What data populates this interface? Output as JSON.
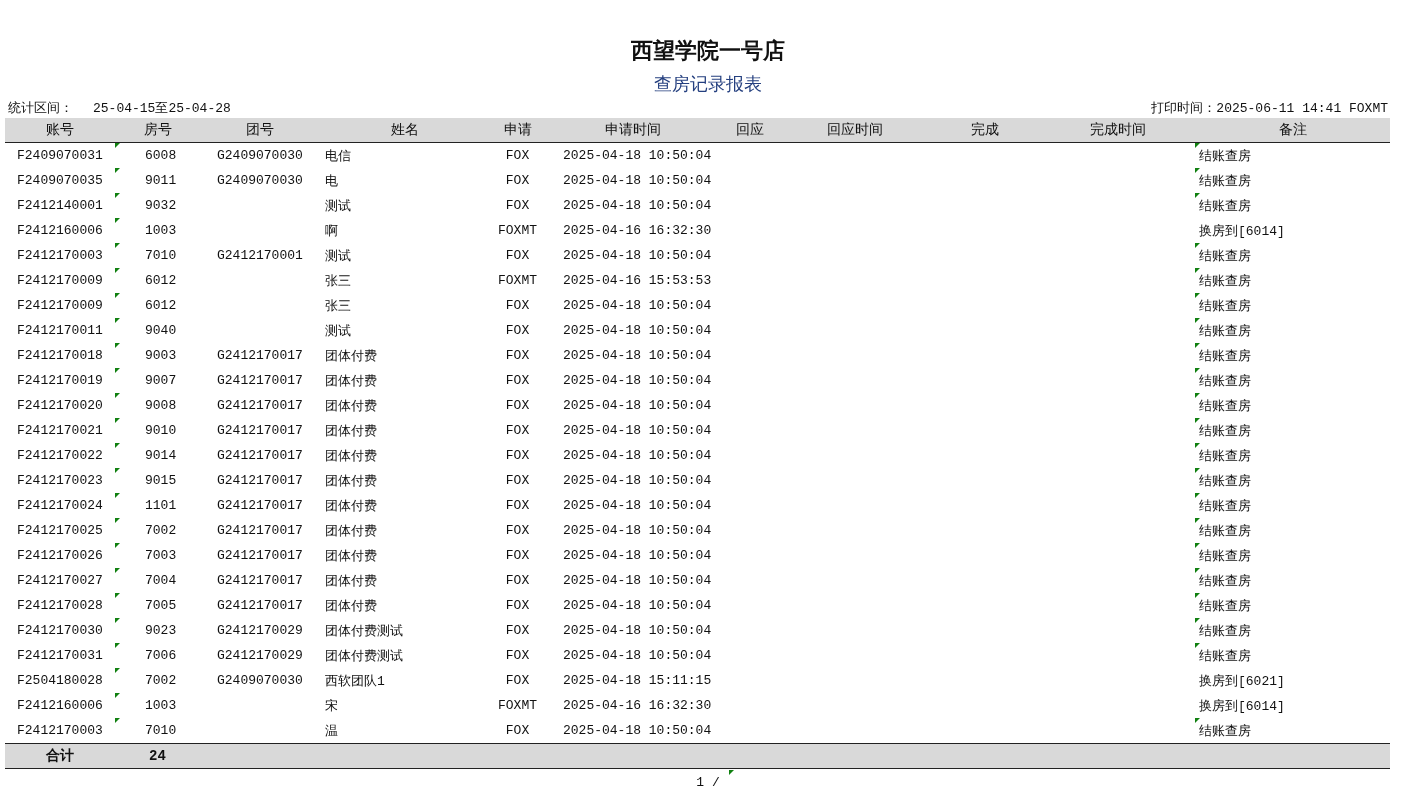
{
  "report": {
    "title": "西望学院一号店",
    "subtitle": "查房记录报表",
    "period_label": "统计区间：",
    "period": "25-04-15至25-04-28",
    "printed": "打印时间：2025-06-11 14:41 FOXMT"
  },
  "table": {
    "columns": [
      "账号",
      "房号",
      "团号",
      "姓名",
      "申请",
      "申请时间",
      "回应",
      "回应时间",
      "完成",
      "完成时间",
      "备注"
    ],
    "rows": [
      {
        "account": "F2409070031",
        "room": "6008",
        "group": "G2409070030",
        "name": "电信",
        "applicant": "FOX",
        "time": "2025-04-18 10:50:04",
        "remark": "结账查房",
        "room_noted": true,
        "remark_noted": true
      },
      {
        "account": "F2409070035",
        "room": "9011",
        "group": "G2409070030",
        "name": "电",
        "applicant": "FOX",
        "time": "2025-04-18 10:50:04",
        "remark": "结账查房",
        "room_noted": true,
        "remark_noted": true
      },
      {
        "account": "F2412140001",
        "room": "9032",
        "name": "测试",
        "applicant": "FOX",
        "time": "2025-04-18 10:50:04",
        "remark": "结账查房",
        "room_noted": true,
        "remark_noted": true
      },
      {
        "account": "F2412160006",
        "room": "1003",
        "name": "啊",
        "applicant": "FOXMT",
        "time": "2025-04-16 16:32:30",
        "remark": "换房到[6014]",
        "room_noted": true,
        "remark_noted": false
      },
      {
        "account": "F2412170003",
        "room": "7010",
        "group": "G2412170001",
        "name": "测试",
        "applicant": "FOX",
        "time": "2025-04-18 10:50:04",
        "remark": "结账查房",
        "room_noted": true,
        "remark_noted": true
      },
      {
        "account": "F2412170009",
        "room": "6012",
        "name": "张三",
        "applicant": "FOXMT",
        "time": "2025-04-16 15:53:53",
        "remark": "结账查房",
        "room_noted": true,
        "remark_noted": true
      },
      {
        "account": "F2412170009",
        "room": "6012",
        "name": "张三",
        "applicant": "FOX",
        "time": "2025-04-18 10:50:04",
        "remark": "结账查房",
        "room_noted": true,
        "remark_noted": true
      },
      {
        "account": "F2412170011",
        "room": "9040",
        "name": "测试",
        "applicant": "FOX",
        "time": "2025-04-18 10:50:04",
        "remark": "结账查房",
        "room_noted": true,
        "remark_noted": true
      },
      {
        "account": "F2412170018",
        "room": "9003",
        "group": "G2412170017",
        "name": "团体付费",
        "applicant": "FOX",
        "time": "2025-04-18 10:50:04",
        "remark": "结账查房",
        "room_noted": true,
        "remark_noted": true
      },
      {
        "account": "F2412170019",
        "room": "9007",
        "group": "G2412170017",
        "name": "团体付费",
        "applicant": "FOX",
        "time": "2025-04-18 10:50:04",
        "remark": "结账查房",
        "room_noted": true,
        "remark_noted": true
      },
      {
        "account": "F2412170020",
        "room": "9008",
        "group": "G2412170017",
        "name": "团体付费",
        "applicant": "FOX",
        "time": "2025-04-18 10:50:04",
        "remark": "结账查房",
        "room_noted": true,
        "remark_noted": true
      },
      {
        "account": "F2412170021",
        "room": "9010",
        "group": "G2412170017",
        "name": "团体付费",
        "applicant": "FOX",
        "time": "2025-04-18 10:50:04",
        "remark": "结账查房",
        "room_noted": true,
        "remark_noted": true
      },
      {
        "account": "F2412170022",
        "room": "9014",
        "group": "G2412170017",
        "name": "团体付费",
        "applicant": "FOX",
        "time": "2025-04-18 10:50:04",
        "remark": "结账查房",
        "room_noted": true,
        "remark_noted": true
      },
      {
        "account": "F2412170023",
        "room": "9015",
        "group": "G2412170017",
        "name": "团体付费",
        "applicant": "FOX",
        "time": "2025-04-18 10:50:04",
        "remark": "结账查房",
        "room_noted": true,
        "remark_noted": true
      },
      {
        "account": "F2412170024",
        "room": "1101",
        "group": "G2412170017",
        "name": "团体付费",
        "applicant": "FOX",
        "time": "2025-04-18 10:50:04",
        "remark": "结账查房",
        "room_noted": true,
        "remark_noted": true
      },
      {
        "account": "F2412170025",
        "room": "7002",
        "group": "G2412170017",
        "name": "团体付费",
        "applicant": "FOX",
        "time": "2025-04-18 10:50:04",
        "remark": "结账查房",
        "room_noted": true,
        "remark_noted": true
      },
      {
        "account": "F2412170026",
        "room": "7003",
        "group": "G2412170017",
        "name": "团体付费",
        "applicant": "FOX",
        "time": "2025-04-18 10:50:04",
        "remark": "结账查房",
        "room_noted": true,
        "remark_noted": true
      },
      {
        "account": "F2412170027",
        "room": "7004",
        "group": "G2412170017",
        "name": "团体付费",
        "applicant": "FOX",
        "time": "2025-04-18 10:50:04",
        "remark": "结账查房",
        "room_noted": true,
        "remark_noted": true
      },
      {
        "account": "F2412170028",
        "room": "7005",
        "group": "G2412170017",
        "name": "团体付费",
        "applicant": "FOX",
        "time": "2025-04-18 10:50:04",
        "remark": "结账查房",
        "room_noted": true,
        "remark_noted": true
      },
      {
        "account": "F2412170030",
        "room": "9023",
        "group": "G2412170029",
        "name": "团体付费测试",
        "applicant": "FOX",
        "time": "2025-04-18 10:50:04",
        "remark": "结账查房",
        "room_noted": true,
        "remark_noted": true
      },
      {
        "account": "F2412170031",
        "room": "7006",
        "group": "G2412170029",
        "name": "团体付费测试",
        "applicant": "FOX",
        "time": "2025-04-18 10:50:04",
        "remark": "结账查房",
        "room_noted": true,
        "remark_noted": true
      },
      {
        "account": "F2504180028",
        "room": "7002",
        "group": "G2409070030",
        "name": "西软团队1",
        "applicant": "FOX",
        "time": "2025-04-18 15:11:15",
        "remark": "换房到[6021]",
        "room_noted": true,
        "remark_noted": false
      },
      {
        "account": "F2412160006",
        "room": "1003",
        "name": "宋",
        "applicant": "FOXMT",
        "time": "2025-04-16 16:32:30",
        "remark": "换房到[6014]",
        "room_noted": true,
        "remark_noted": false
      },
      {
        "account": "F2412170003",
        "room": "7010",
        "name": "温",
        "applicant": "FOX",
        "time": "2025-04-18 10:50:04",
        "remark": "结账查房",
        "room_noted": true,
        "remark_noted": true
      }
    ],
    "total_label": "合计",
    "total_count": "24"
  },
  "page_footer": {
    "page": "1 /",
    "noted": true
  }
}
